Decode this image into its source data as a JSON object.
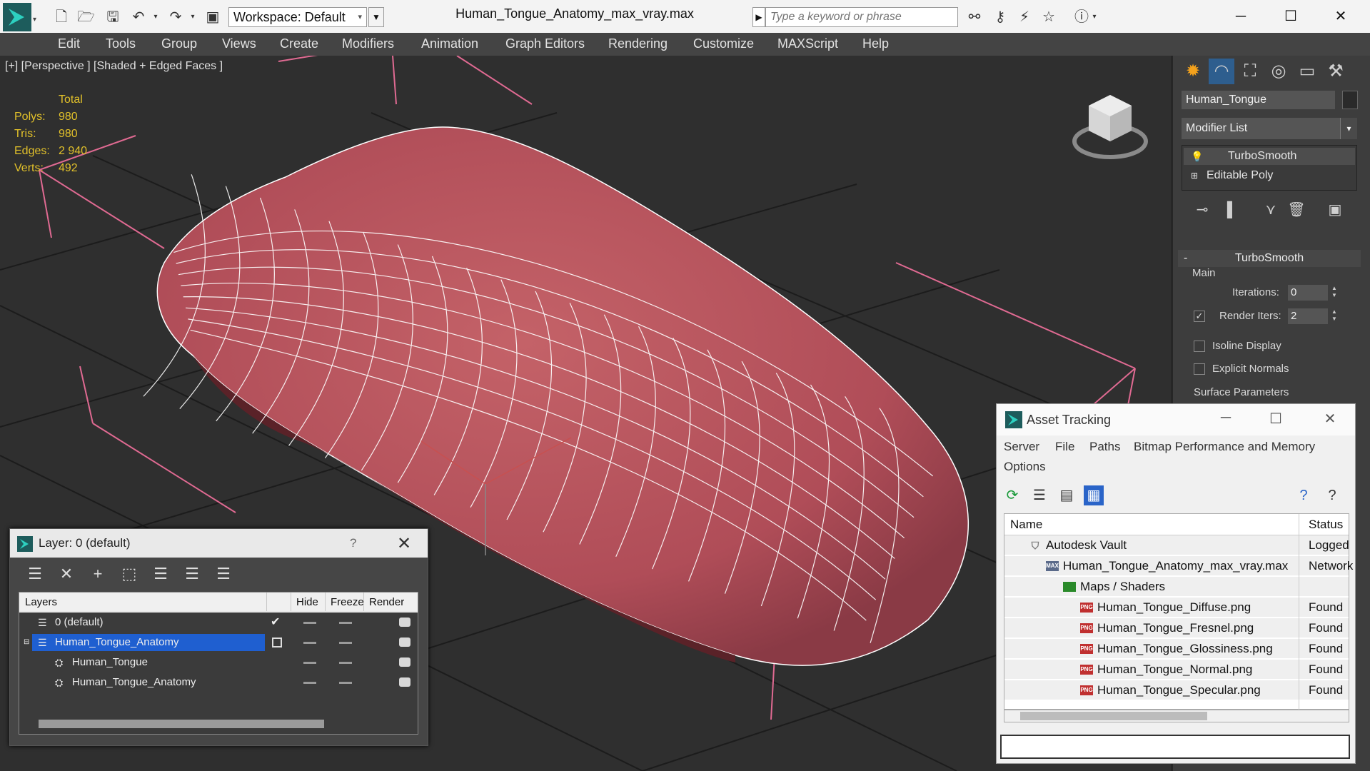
{
  "titlebar": {
    "workspace": "Workspace: Default",
    "doc_title": "Human_Tongue_Anatomy_max_vray.max",
    "search_placeholder": "Type a keyword or phrase"
  },
  "menu": [
    "Edit",
    "Tools",
    "Group",
    "Views",
    "Create",
    "Modifiers",
    "Animation",
    "Graph Editors",
    "Rendering",
    "Customize",
    "MAXScript",
    "Help"
  ],
  "viewport": {
    "label": "[+] [Perspective ] [Shaded + Edged Faces ]",
    "stats": {
      "header": "Total",
      "polys_label": "Polys:",
      "polys": "980",
      "tris_label": "Tris:",
      "tris": "980",
      "edges_label": "Edges:",
      "edges": "2 940",
      "verts_label": "Verts:",
      "verts": "492"
    }
  },
  "command_panel": {
    "object_name": "Human_Tongue",
    "modifier_list": "Modifier List",
    "stack": [
      "TurboSmooth",
      "Editable Poly"
    ],
    "rollout_title": "TurboSmooth",
    "main_label": "Main",
    "iterations_label": "Iterations:",
    "iterations": "0",
    "render_iters_label": "Render Iters:",
    "render_iters": "2",
    "isoline_label": "Isoline Display",
    "explicit_normals_label": "Explicit Normals",
    "surface_params_label": "Surface Parameters"
  },
  "layer_dialog": {
    "title": "Layer: 0 (default)",
    "help": "?",
    "columns": {
      "layers": "Layers",
      "hide": "Hide",
      "freeze": "Freeze",
      "render": "Render"
    },
    "rows": [
      {
        "name": "0 (default)"
      },
      {
        "name": "Human_Tongue_Anatomy"
      },
      {
        "name": "Human_Tongue"
      },
      {
        "name": "Human_Tongue_Anatomy"
      }
    ]
  },
  "asset_dialog": {
    "title": "Asset Tracking",
    "menus": [
      "Server",
      "File",
      "Paths",
      "Bitmap Performance and Memory",
      "Options"
    ],
    "columns": {
      "name": "Name",
      "status": "Status"
    },
    "rows": [
      {
        "name": "Autodesk Vault",
        "status": "Logged"
      },
      {
        "name": "Human_Tongue_Anatomy_max_vray.max",
        "status": "Network"
      },
      {
        "name": "Maps / Shaders",
        "status": ""
      },
      {
        "name": "Human_Tongue_Diffuse.png",
        "status": "Found"
      },
      {
        "name": "Human_Tongue_Fresnel.png",
        "status": "Found"
      },
      {
        "name": "Human_Tongue_Glossiness.png",
        "status": "Found"
      },
      {
        "name": "Human_Tongue_Normal.png",
        "status": "Found"
      },
      {
        "name": "Human_Tongue_Specular.png",
        "status": "Found"
      }
    ]
  },
  "icons": {
    "png_badge": "PNG",
    "max_badge": "MAX"
  },
  "colors": {
    "stats": "#e2c12a",
    "selected_layer": "#1f5fd0",
    "tongue": "#b4505a"
  }
}
